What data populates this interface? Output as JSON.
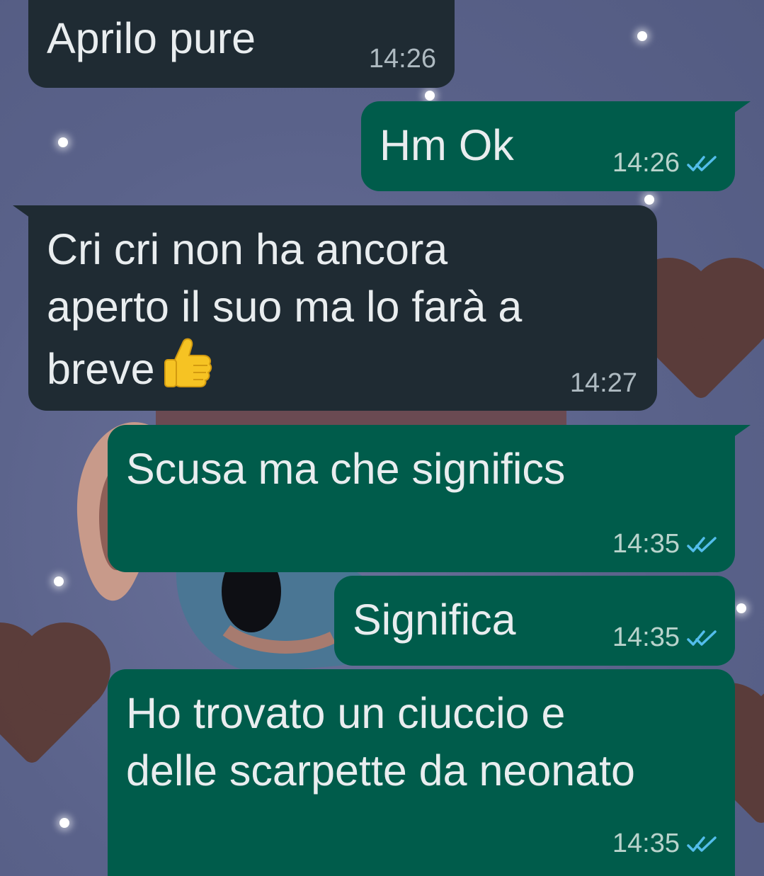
{
  "conversation": {
    "messages": [
      {
        "direction": "incoming",
        "text": "Aprilo pure",
        "time": "14:26"
      },
      {
        "direction": "outgoing",
        "text": "Hm Ok",
        "time": "14:26",
        "status": "read"
      },
      {
        "direction": "incoming",
        "text_line1": "Cri cri non ha ancora",
        "text_line2": "aperto il suo ma lo farà a",
        "text_line3": "breve",
        "emoji": "thumbs-up",
        "time": "14:27"
      },
      {
        "direction": "outgoing",
        "text": "Scusa ma che significs",
        "time": "14:35",
        "status": "read"
      },
      {
        "direction": "outgoing",
        "text": "Significa",
        "time": "14:35",
        "status": "read"
      },
      {
        "direction": "outgoing",
        "text_line1": "Ho trovato un ciuccio e",
        "text_line2": "delle scarpette da neonato",
        "time": "14:35",
        "status": "read"
      }
    ]
  },
  "theme": {
    "incoming_bubble": "#1f2b33",
    "outgoing_bubble": "#005c4b",
    "message_text": "#e9edef",
    "read_ticks": "#53bdeb",
    "wallpaper": "#5e6790"
  }
}
